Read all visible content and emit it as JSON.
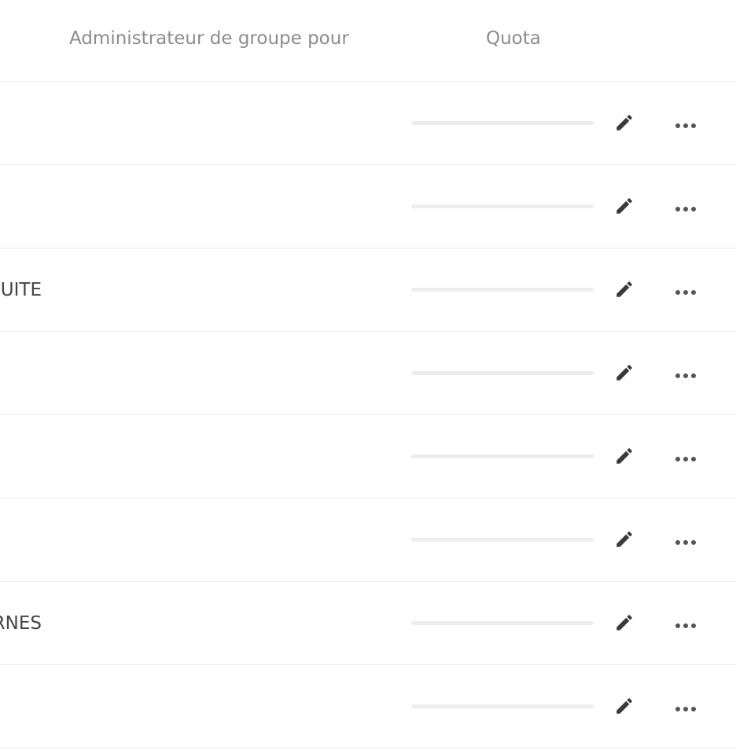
{
  "header": {
    "group_admin_label": "Administrateur de groupe pour",
    "quota_label": "Quota"
  },
  "rows": [
    {
      "text": "",
      "quota_fraction": 0
    },
    {
      "text": "",
      "quota_fraction": 0
    },
    {
      "text": "SUITE",
      "quota_fraction": 0
    },
    {
      "text": "",
      "quota_fraction": 0
    },
    {
      "text": "",
      "quota_fraction": 0
    },
    {
      "text": "",
      "quota_fraction": 0
    },
    {
      "text": "RNES",
      "quota_fraction": 0
    },
    {
      "text": "",
      "quota_fraction": 0
    }
  ],
  "icons": {
    "edit": "pencil-icon",
    "more": "more-horizontal-icon"
  },
  "colors": {
    "header_text": "#8c8c8c",
    "row_text": "#444444",
    "quota_track": "#ededed",
    "icon": "#3a3a3a",
    "divider": "#ececec"
  }
}
